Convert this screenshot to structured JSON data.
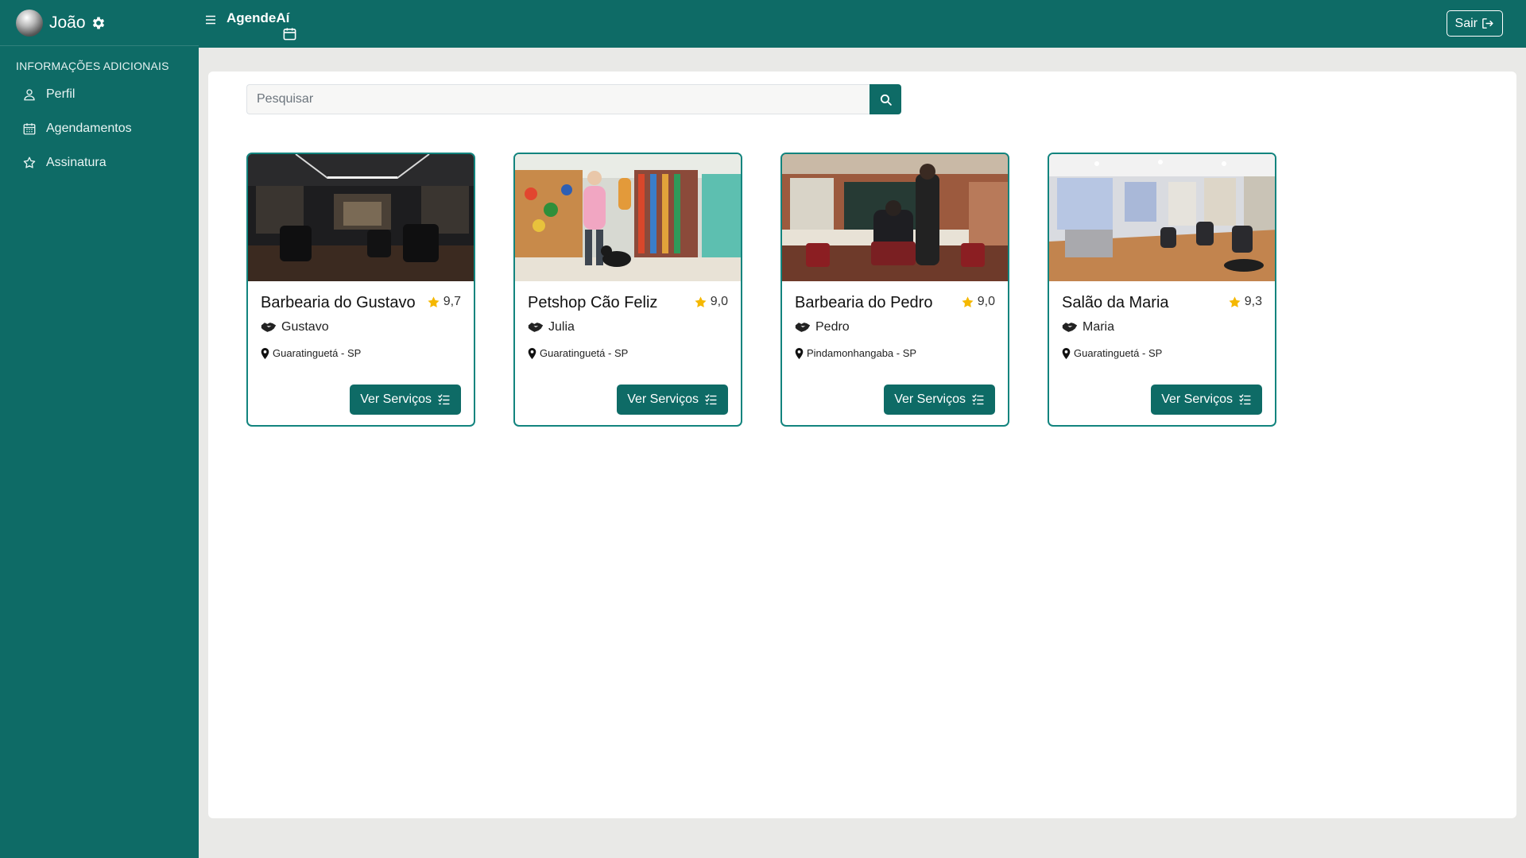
{
  "sidebar": {
    "user_name": "João",
    "section_title": "INFORMAÇÕES ADICIONAIS",
    "items": [
      {
        "label": "Perfil",
        "icon": "user-icon"
      },
      {
        "label": "Agendamentos",
        "icon": "calendar-icon"
      },
      {
        "label": "Assinatura",
        "icon": "star-icon"
      }
    ]
  },
  "header": {
    "brand": "AgendeAí",
    "logout_label": "Sair"
  },
  "search": {
    "placeholder": "Pesquisar"
  },
  "cards": [
    {
      "title": "Barbearia do Gustavo",
      "rating": "9,7",
      "owner": "Gustavo",
      "city": "Guaratinguetá - SP",
      "button": "Ver Serviços"
    },
    {
      "title": "Petshop Cão Feliz",
      "rating": "9,0",
      "owner": "Julia",
      "city": "Guaratinguetá - SP",
      "button": "Ver Serviços"
    },
    {
      "title": "Barbearia do Pedro",
      "rating": "9,0",
      "owner": "Pedro",
      "city": "Pindamonhangaba - SP",
      "button": "Ver Serviços"
    },
    {
      "title": "Salão da Maria",
      "rating": "9,3",
      "owner": "Maria",
      "city": "Guaratinguetá - SP",
      "button": "Ver Serviços"
    }
  ],
  "colors": {
    "primary": "#0e6b66",
    "card_border": "#12847e",
    "star": "#f5b800",
    "page_bg": "#e9e9e7"
  }
}
